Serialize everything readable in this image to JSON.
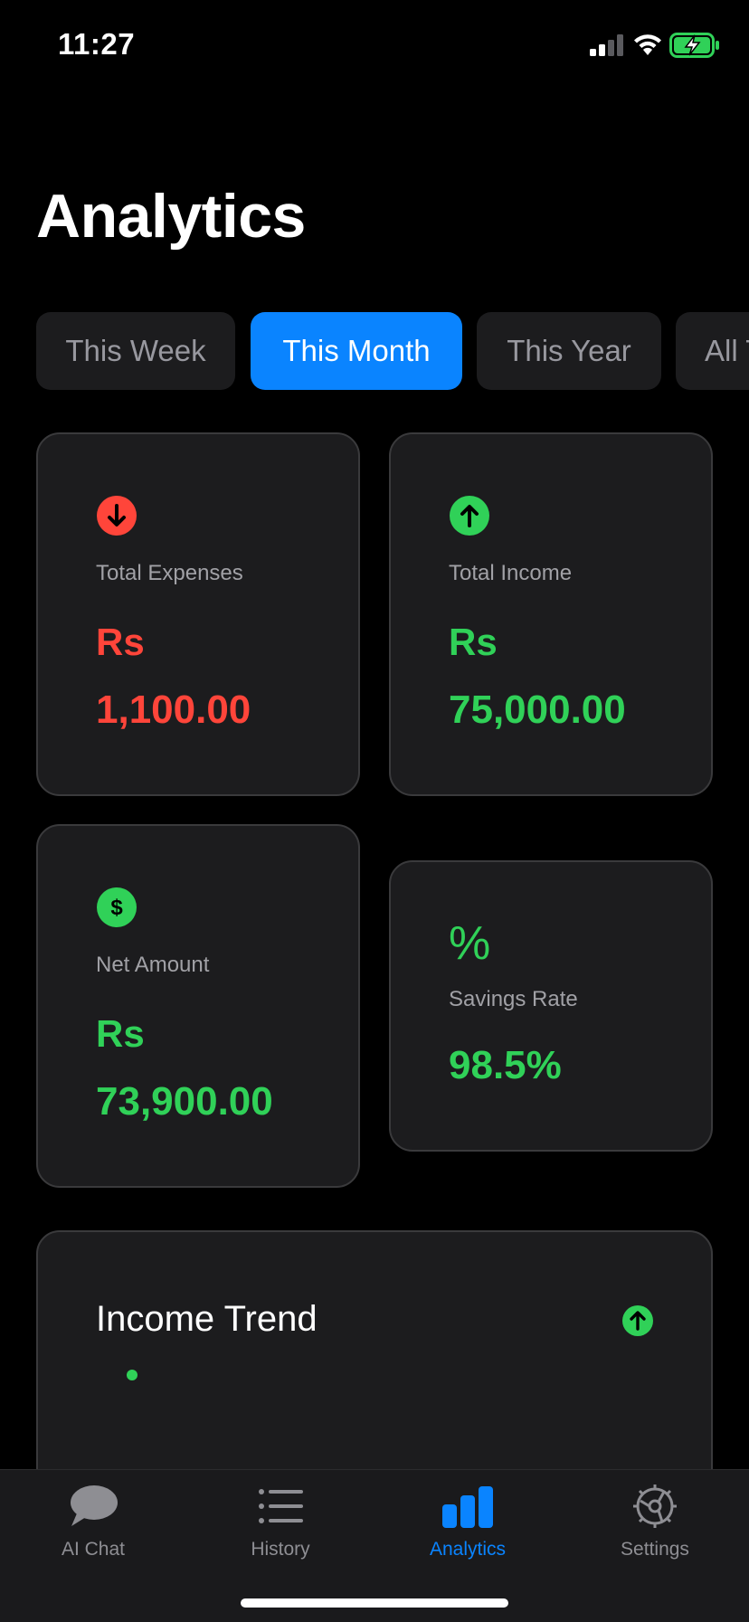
{
  "status_bar": {
    "time": "11:27",
    "signal_icon": "cellular-signal-icon",
    "wifi_icon": "wifi-icon",
    "battery_icon": "battery-charging-icon"
  },
  "page": {
    "title": "Analytics"
  },
  "period_tabs": [
    {
      "label": "This Week",
      "selected": false
    },
    {
      "label": "This Month",
      "selected": true
    },
    {
      "label": "This Year",
      "selected": false
    },
    {
      "label": "All Time",
      "selected": false
    }
  ],
  "cards": {
    "expenses": {
      "label": "Total Expenses",
      "currency": "Rs",
      "amount": "1,100.00",
      "icon": "arrow-down-circle-icon",
      "color": "#ff453a"
    },
    "income": {
      "label": "Total Income",
      "currency": "Rs",
      "amount": "75,000.00",
      "icon": "arrow-up-circle-icon",
      "color": "#30d158"
    },
    "net": {
      "label": "Net Amount",
      "currency": "Rs",
      "amount": "73,900.00",
      "icon": "dollar-circle-icon",
      "color": "#30d158"
    },
    "savings": {
      "label": "Savings Rate",
      "symbol": "%",
      "value": "98.5%",
      "color": "#30d158"
    }
  },
  "income_trend": {
    "title": "Income Trend",
    "icon": "arrow-up-circle-icon",
    "accent": "#30d158"
  },
  "tab_bar": {
    "items": [
      {
        "label": "AI Chat",
        "icon": "chat-bubble-icon",
        "active": false
      },
      {
        "label": "History",
        "icon": "list-icon",
        "active": false
      },
      {
        "label": "Analytics",
        "icon": "bar-chart-icon",
        "active": true
      },
      {
        "label": "Settings",
        "icon": "gear-icon",
        "active": false
      }
    ],
    "active_color": "#0a84ff",
    "inactive_color": "#8e8e93"
  }
}
